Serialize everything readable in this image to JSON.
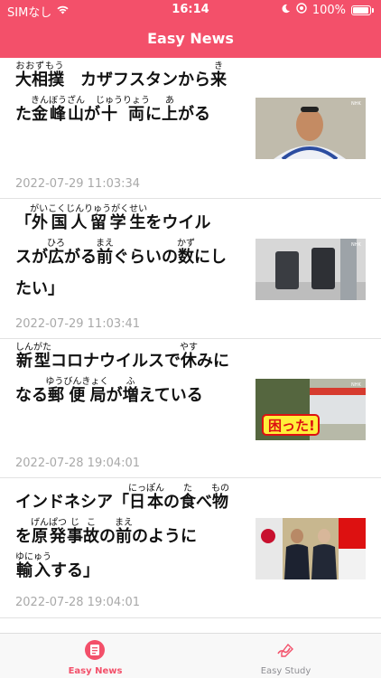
{
  "status_bar": {
    "carrier": "SIMなし",
    "time": "16:14",
    "battery_percent": "100%",
    "battery_level": 1.0
  },
  "header": {
    "title": "Easy News"
  },
  "articles": [
    {
      "date": "2022-07-29 11:03:34"
    },
    {
      "date": "2022-07-29 11:03:41"
    },
    {
      "date": "2022-07-28 19:04:01"
    },
    {
      "date": "2022-07-28 19:04:01"
    }
  ],
  "tabs": [
    {
      "label": "Easy News",
      "active": true
    },
    {
      "label": "Easy Study",
      "active": false
    }
  ],
  "colors": {
    "header": "#f3506a",
    "accent": "#f3506a",
    "date_text": "#a9a9a9",
    "inactive_tab": "#8e8e93"
  },
  "icons": [
    "wifi-icon",
    "moon-icon",
    "location-icon",
    "battery-icon",
    "news-icon",
    "study-icon"
  ]
}
